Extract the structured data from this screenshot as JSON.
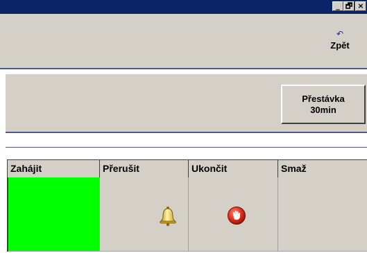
{
  "window": {
    "controls": {
      "minimize": "_",
      "maximize": "🗗",
      "close": "×"
    }
  },
  "toolbar": {
    "back_icon": "↶",
    "back_label": "Zpět"
  },
  "panel": {
    "break_button_line1": "Přestávka",
    "break_button_line2": "30min"
  },
  "grid": {
    "columns": [
      "Zahájit",
      "Přerušit",
      "Ukončit",
      "Smaž"
    ],
    "start_cell_color": "#00ff00"
  },
  "icons": {
    "pause": "bell-icon",
    "end": "stop-icon"
  },
  "colors": {
    "titlebar": "#0a246a",
    "face": "#d4d0c8",
    "accent_line": "#4a5a8a"
  }
}
